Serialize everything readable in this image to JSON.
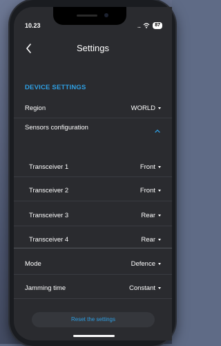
{
  "status_bar": {
    "time": "10.23",
    "signal_dots": "...",
    "battery": "87"
  },
  "nav": {
    "title": "Settings"
  },
  "section": {
    "title": "DEVICE SETTINGS"
  },
  "region": {
    "label": "Region",
    "value": "WORLD"
  },
  "sensors": {
    "label": "Sensors configuration"
  },
  "transceivers": [
    {
      "label": "Transceiver 1",
      "value": "Front"
    },
    {
      "label": "Transceiver 2",
      "value": "Front"
    },
    {
      "label": "Transceiver 3",
      "value": "Rear"
    },
    {
      "label": "Transceiver 4",
      "value": "Rear"
    }
  ],
  "mode": {
    "label": "Mode",
    "value": "Defence"
  },
  "jamming": {
    "label": "Jamming time",
    "value": "Constant"
  },
  "reset": {
    "label": "Reset the settings"
  },
  "colors": {
    "accent": "#2e9fe3",
    "background": "#2a2b2f"
  }
}
